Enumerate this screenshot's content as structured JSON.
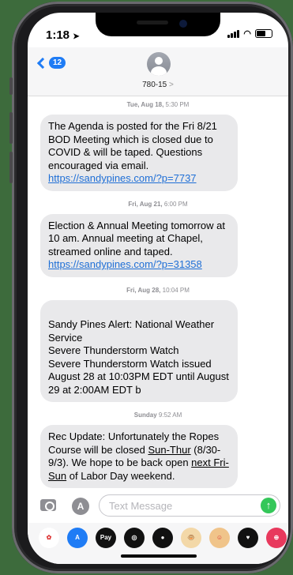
{
  "status": {
    "time": "1:18"
  },
  "header": {
    "back_count": "12",
    "contact": "780-15",
    "contact_chevron": ">"
  },
  "messages": [
    {
      "timestamp_day": "Tue, Aug 18,",
      "timestamp_time": "5:30 PM",
      "text": "The Agenda is posted for the Fri 8/21 BOD Meeting which is closed due to COVID & will be taped. Questions encouraged via email. ",
      "link": "https://sandypines.com/?p=7737"
    },
    {
      "timestamp_day": "Fri, Aug 21,",
      "timestamp_time": "6:00 PM",
      "text": "Election & Annual Meeting tomorrow at 10 am. Annual meeting at Chapel, streamed online and taped. ",
      "link": "https://sandypines.com/?p=31358"
    },
    {
      "timestamp_day": "Fri, Aug 28,",
      "timestamp_time": "10:04 PM",
      "text": "Sandy Pines Alert: National Weather Service\n Severe Thunderstorm Watch\nSevere Thunderstorm Watch issued August 28 at 10:03PM EDT until August 29 at 2:00AM EDT b",
      "link": ""
    },
    {
      "timestamp_day": "Sunday",
      "timestamp_time": "9:52 AM",
      "text_a": "Rec Update: Unfortunately the Ropes Course will be closed ",
      "text_b": "Sun-Thur",
      "text_c": " (8/30-9/3). We hope to be back open ",
      "text_d": "next Fri-Sun",
      "text_e": " of Labor Day weekend."
    }
  ],
  "compose": {
    "placeholder": "Text Message",
    "send_glyph": "↑",
    "apps_glyph": "A"
  },
  "tray": [
    {
      "name": "photos-app-icon",
      "label": "✿",
      "color": "#ffffff"
    },
    {
      "name": "app-store-icon",
      "label": "A",
      "color": "#1f7cf5"
    },
    {
      "name": "apple-pay-icon",
      "label": "Pay",
      "color": "#111111"
    },
    {
      "name": "activity-icon",
      "label": "◎",
      "color": "#111111"
    },
    {
      "name": "digital-touch-icon",
      "label": "●",
      "color": "#111111"
    },
    {
      "name": "animoji-icon",
      "label": "🐵",
      "color": "#f3d8a8"
    },
    {
      "name": "memoji-icon",
      "label": "☺",
      "color": "#f0c48a"
    },
    {
      "name": "heart-icon",
      "label": "♥",
      "color": "#111111"
    },
    {
      "name": "music-icon",
      "label": "⊕",
      "color": "#e8395d"
    }
  ],
  "colors": {
    "accent": "#1f7cf5",
    "send": "#34c759",
    "bubble": "#e9e9eb",
    "background": "#3d6b3c"
  }
}
